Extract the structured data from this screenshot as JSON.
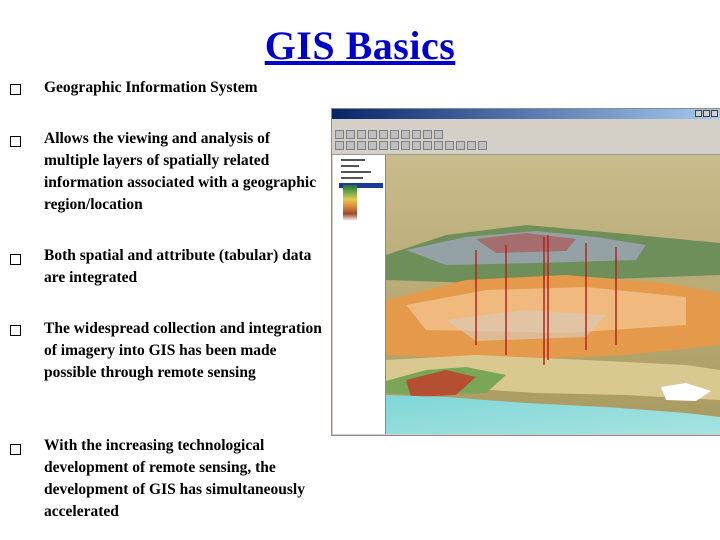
{
  "slide": {
    "title": "GIS Basics",
    "bullets": [
      "Geographic Information System",
      "Allows the viewing and analysis of multiple layers of spatially related information associated with a geographic region/location",
      "Both spatial and attribute (tabular) data are integrated",
      "The widespread collection and integration of imagery into GIS has been made possible through remote sensing",
      "With the increasing technological development of remote sensing, the development of GIS has simultaneously accelerated"
    ]
  },
  "colors": {
    "title": "#0000cc",
    "text": "#000000",
    "background": "#ffffff"
  },
  "icons": {
    "bullet": "hollow-square-icon"
  },
  "screenshot": {
    "description_icon": "gis-3d-terrain-screenshot"
  }
}
